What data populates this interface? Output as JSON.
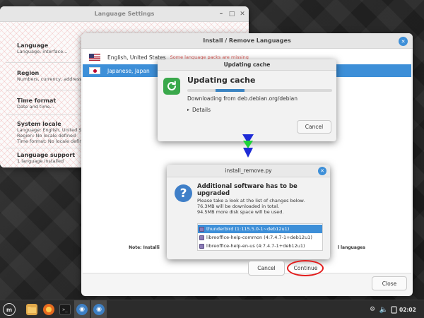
{
  "colors": {
    "accent": "#3b84c2",
    "selection": "#3d8fd8",
    "highlight_circle": "#e31c1c",
    "warning_text": "#d9534f"
  },
  "language_settings": {
    "title": "Language Settings",
    "sections": [
      {
        "heading": "Language",
        "lines": [
          "Language, interface..."
        ]
      },
      {
        "heading": "Region",
        "lines": [
          "Numbers, currency, addresses,"
        ]
      },
      {
        "heading": "Time format",
        "lines": [
          "Date and time..."
        ]
      },
      {
        "heading": "System locale",
        "lines": [
          "Language: English, United States",
          "Region: No locale defined",
          "Time format: No locale defined"
        ]
      },
      {
        "heading": "Language support",
        "lines": [
          "1 language installed"
        ]
      }
    ]
  },
  "install_remove": {
    "title": "Install / Remove Languages",
    "languages": [
      {
        "name": "English, United States",
        "status": "Some language packs are missing",
        "flag": "us-flag-icon",
        "selected": false
      },
      {
        "name": "Japanese, Japan",
        "status": "",
        "flag": "japan-flag-icon",
        "selected": true
      }
    ],
    "note": "Note: Installi",
    "note_tail": "l languages",
    "close_label": "Close"
  },
  "updating_cache": {
    "window_title": "Updating cache",
    "heading": "Updating cache",
    "status": "Downloading from deb.debian.org/debian",
    "progress_fraction": 0.2,
    "details_label": "Details",
    "cancel_label": "Cancel",
    "icon": "refresh-icon"
  },
  "upgrade_dialog": {
    "window_title": "install_remove.py",
    "heading": "Additional software has to be upgraded",
    "message": "Please take a look at the list of changes below.",
    "download": "76.3MB will be downloaded in total.",
    "disk": "94.5MB more disk space will be used.",
    "packages": [
      {
        "label": "thunderbird (1:115.5.0-1~deb12u1)",
        "selected": true
      },
      {
        "label": "libreoffice-help-common (4:7.4.7-1+deb12u1)",
        "selected": false
      },
      {
        "label": "libreoffice-help-en-us (4:7.4.7-1+deb12u1)",
        "selected": false
      }
    ],
    "cancel_label": "Cancel",
    "continue_label": "Continue",
    "icon": "question-icon"
  },
  "taskbar": {
    "clock": "02:02",
    "icons": [
      "menu-icon",
      "files-icon",
      "firefox-icon",
      "terminal-icon",
      "language-app-icon",
      "language-app-icon"
    ]
  }
}
